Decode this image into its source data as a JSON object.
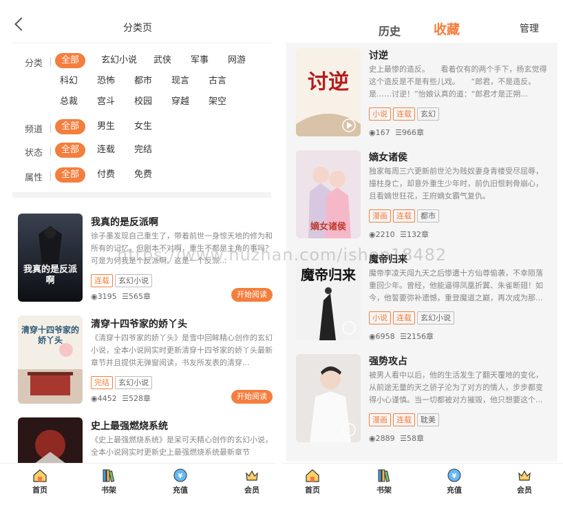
{
  "left": {
    "title": "分类页",
    "filters": [
      {
        "label": "分类",
        "rows": [
          [
            "全部",
            "玄幻小说",
            "武侠",
            "军事",
            "网游"
          ],
          [
            "科幻",
            "恐怖",
            "都市",
            "现言",
            "古言"
          ],
          [
            "总裁",
            "宫斗",
            "校园",
            "穿越",
            "架空"
          ]
        ]
      },
      {
        "label": "频道",
        "rows": [
          [
            "全部",
            "男生",
            "女生"
          ]
        ]
      },
      {
        "label": "状态",
        "rows": [
          [
            "全部",
            "连载",
            "完结"
          ]
        ]
      },
      {
        "label": "属性",
        "rows": [
          [
            "全部",
            "付费",
            "免费"
          ]
        ]
      }
    ],
    "books": [
      {
        "title": "我真的是反派啊",
        "desc": "徐子墨发现自己重生了，带着前世一身惊天地的修为和所有的记忆。但剧本不对啊，重生不都是主角的事吗？可是为何我是个反派啊。这是一个反派...",
        "tags": [
          "连载",
          "玄幻小说"
        ],
        "views": "3195",
        "chapters": "565章",
        "read": "开始阅读",
        "cover_text": "我真的是反派啊"
      },
      {
        "title": "清穿十四爷家的娇丫头",
        "desc": "《清穿十四爷家的娇丫头》是雪中回眸精心创作的玄幻小说，全本小说网实时更新清穿十四爷家的娇丫头最新章节并且提供无弹窗阅读，书友所发表的清穿...",
        "tags": [
          "完结",
          "玄幻小说"
        ],
        "views": "4452",
        "chapters": "528章",
        "read": "开始阅读",
        "cover_text": "清穿十四爷家的娇丫头"
      },
      {
        "title": "史上最强燃烧系统",
        "desc": "《史上最强燃烧系统》是呆可天精心创作的玄幻小说，全本小说网实时更新史上最强燃烧系统最新章节",
        "tags": [],
        "views": "",
        "chapters": "",
        "read": "",
        "cover_text": ""
      }
    ]
  },
  "right": {
    "tab_history": "历史",
    "tab_fav": "收藏",
    "manage": "管理",
    "books": [
      {
        "title": "讨逆",
        "desc": "史上最惨的造反。　　看着仅有的两个手下，杨玄觉得这个造反是不是有些儿戏。　　“郎君，不是造反。是……讨逆！”怡娘认真的道：“郎君才是正朔...",
        "tags": [
          "小说",
          "连载",
          "玄幻"
        ],
        "views": "167",
        "chapters": "966章",
        "cover_text": "讨逆"
      },
      {
        "title": "嫡女诸侯",
        "desc": "独家每周三六更新前世沦为贱奴妻身青楼受尽屈辱，撞柱身亡，却意外重生少年时，前仇旧恨刺骨崩心，且看嫡世狂花，王府嫡女霸气复仇。",
        "tags": [
          "漫画",
          "连载",
          "都市"
        ],
        "views": "2210",
        "chapters": "132章",
        "cover_text": "嫡女诸侯"
      },
      {
        "title": "魔帝归来",
        "desc": "魔帝李凌天闯九天之后惨遭十方仙尊偷袭，不幸陨落重回少年。曾经，他能逼得凤凰折翼、朱雀断翅！如今，他誓要弥补遗憾，重登魔道之巅，再次成为那...",
        "tags": [
          "小说",
          "连载",
          "玄幻小说"
        ],
        "views": "6958",
        "chapters": "2156章",
        "cover_text": "魔帝归来"
      },
      {
        "title": "强势攻占",
        "desc": "被男人看中以后，他的生活发生了翻天覆地的变化，从前途无量的天之骄子沦为了对方的情人，步步都变得小心谨慎。当一切都被对方摧毁，他只想要这个...",
        "tags": [
          "漫画",
          "连载",
          "耽美"
        ],
        "views": "2889",
        "chapters": "58章",
        "cover_text": ""
      }
    ]
  },
  "tabbar": [
    {
      "label": "首页",
      "icon": "home-icon"
    },
    {
      "label": "书架",
      "icon": "bookshelf-icon"
    },
    {
      "label": "充值",
      "icon": "recharge-icon"
    },
    {
      "label": "会员",
      "icon": "crown-icon"
    }
  ],
  "watermark": "https://www.huzhan.com/ishop18482",
  "colors": {
    "accent": "#f47e3d"
  }
}
